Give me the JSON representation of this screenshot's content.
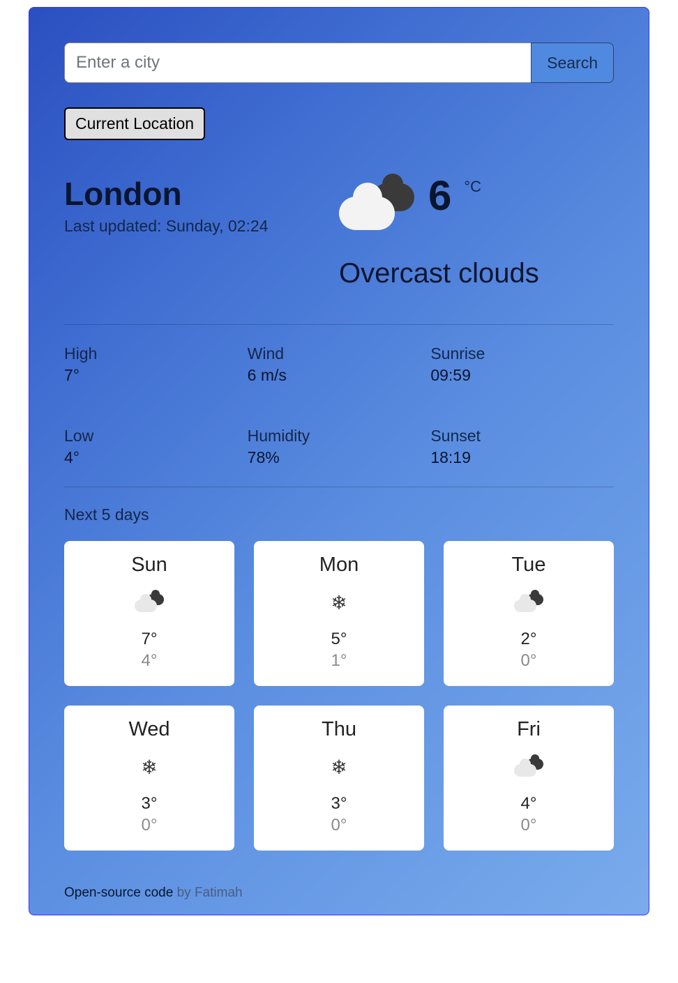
{
  "search": {
    "placeholder": "Enter a city",
    "button_label": "Search"
  },
  "current_location_label": "Current Location",
  "city": "London",
  "last_updated_prefix": "Last updated: ",
  "last_updated_time": "Sunday, 02:24",
  "current": {
    "temperature": "6",
    "unit": "°C",
    "condition": "Overcast clouds",
    "icon": "overcast-clouds"
  },
  "stats": {
    "high": {
      "label": "High",
      "value": "7°"
    },
    "wind": {
      "label": "Wind",
      "value": "6 m/s"
    },
    "sunrise": {
      "label": "Sunrise",
      "value": "09:59"
    },
    "low": {
      "label": "Low",
      "value": "4°"
    },
    "humidity": {
      "label": "Humidity",
      "value": "78%"
    },
    "sunset": {
      "label": "Sunset",
      "value": "18:19"
    }
  },
  "forecast_title": "Next 5 days",
  "forecast": [
    {
      "day": "Sun",
      "icon": "cloud",
      "high": "7°",
      "low": "4°"
    },
    {
      "day": "Mon",
      "icon": "snow",
      "high": "5°",
      "low": "1°"
    },
    {
      "day": "Tue",
      "icon": "cloud",
      "high": "2°",
      "low": "0°"
    },
    {
      "day": "Wed",
      "icon": "snow",
      "high": "3°",
      "low": "0°"
    },
    {
      "day": "Thu",
      "icon": "snow",
      "high": "3°",
      "low": "0°"
    },
    {
      "day": "Fri",
      "icon": "cloud",
      "high": "4°",
      "low": "0°"
    }
  ],
  "footer": {
    "code_text": "Open-source code",
    "by_text": " by Fatimah"
  }
}
